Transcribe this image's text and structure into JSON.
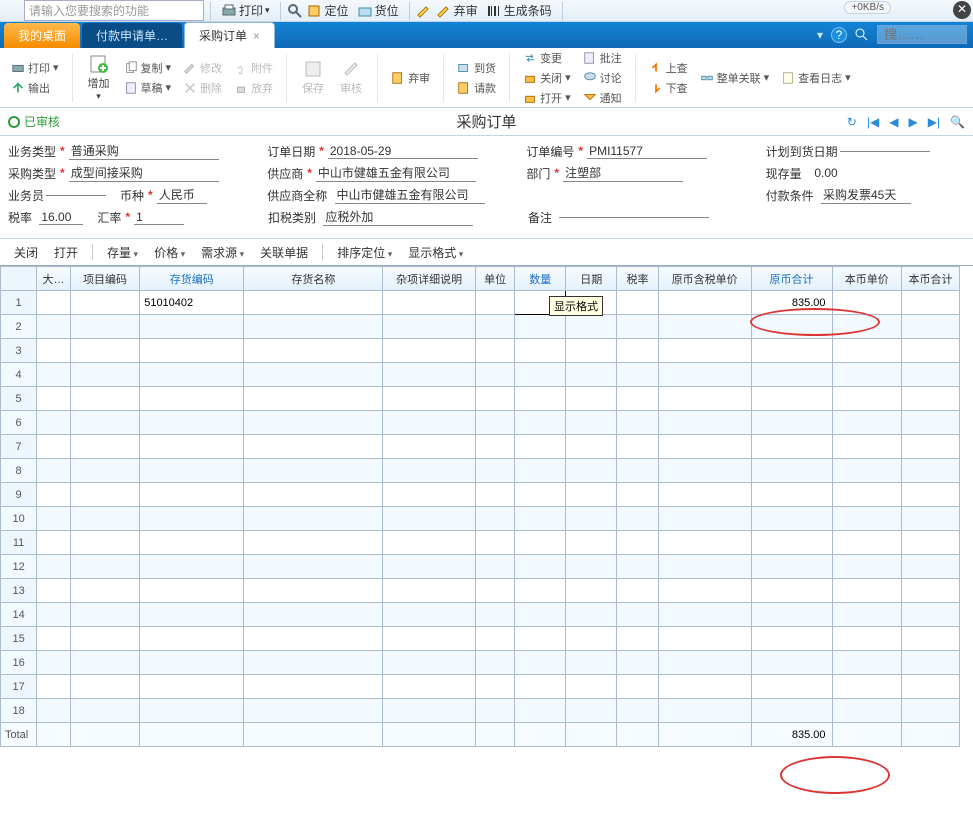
{
  "top": {
    "search_placeholder": "请输入您要搜索的功能",
    "print": "打印",
    "locate": "定位",
    "inventory": "货位",
    "reject": "弃审",
    "barcode": "生成条码",
    "speed": "+0KB/s"
  },
  "tabs": {
    "desktop": "我的桌面",
    "pay": "付款申请单…",
    "po": "采购订单",
    "help": "?",
    "search_ph": "搜……"
  },
  "ribbon": {
    "print": "打印",
    "export": "输出",
    "add": "增加",
    "copy": "复制",
    "edit": "修改",
    "attach": "附件",
    "draft": "草稿",
    "delete": "删除",
    "unlock": "放弃",
    "save": "保存",
    "audit": "审核",
    "reject": "弃审",
    "arrival": "到货",
    "request": "请款",
    "change": "变更",
    "close": "关闭",
    "open": "打开",
    "approve": "批注",
    "discuss": "讨论",
    "notify": "通知",
    "prev": "上查",
    "next": "下查",
    "assoc": "整单关联",
    "log": "查看日志"
  },
  "title": {
    "approved": "已审核",
    "doc": "采购订单"
  },
  "nav": {
    "refresh": "↻",
    "first": "|◀",
    "prev": "◀",
    "next": "▶",
    "last": "▶|",
    "zoom": "🔍"
  },
  "form": {
    "biz_type": {
      "lbl": "业务类型",
      "val": "普通采购"
    },
    "proc_type": {
      "lbl": "采购类型",
      "val": "成型间接采购"
    },
    "salesman": {
      "lbl": "业务员",
      "val": ""
    },
    "tax_rate": {
      "lbl": "税率",
      "val": "16.00"
    },
    "currency": {
      "lbl": "币种",
      "val": "人民币"
    },
    "ex_rate": {
      "lbl": "汇率",
      "val": "1"
    },
    "order_date": {
      "lbl": "订单日期",
      "val": "2018-05-29"
    },
    "supplier": {
      "lbl": "供应商",
      "val": "中山市健雄五金有限公司"
    },
    "supplier_full": {
      "lbl": "供应商全称",
      "val": "中山市健雄五金有限公司"
    },
    "tax_class": {
      "lbl": "扣税类别",
      "val": "应税外加"
    },
    "order_no": {
      "lbl": "订单编号",
      "val": "PMI11577"
    },
    "dept": {
      "lbl": "部门",
      "val": "注塑部"
    },
    "remark": {
      "lbl": "备注",
      "val": ""
    },
    "plan_date": {
      "lbl": "计划到货日期",
      "val": ""
    },
    "stock": {
      "lbl": "现存量",
      "val": "0.00"
    },
    "pay_term": {
      "lbl": "付款条件",
      "val": "采购发票45天"
    }
  },
  "subtool": {
    "close": "关闭",
    "open": "打开",
    "stock": "存量",
    "price": "价格",
    "demand": "需求源",
    "assoc": "关联单据",
    "sort": "排序定位",
    "format": "显示格式"
  },
  "tooltip": "显示格式",
  "cols": {
    "c1": "大…",
    "c2": "项目编码",
    "c3": "存货编码",
    "c4": "存货名称",
    "c5": "杂项详细说明",
    "c6": "单位",
    "c7": "数量",
    "c8": "日期",
    "c9": "税率",
    "c10": "原币含税单价",
    "c11": "原币合计",
    "c12": "本币单价",
    "c13": "本币合计"
  },
  "row1": {
    "code": "51010402",
    "amount": "835.00"
  },
  "total": {
    "label": "Total",
    "amount": "835.00"
  },
  "row_count": 18
}
